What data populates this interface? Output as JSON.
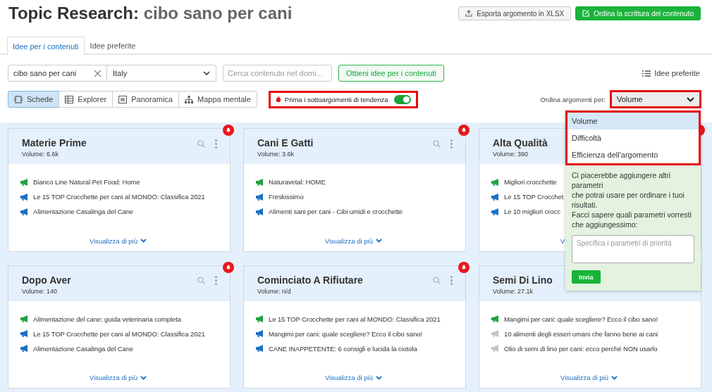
{
  "title": {
    "prefix": "Topic Research:",
    "topic": "cibo sano per cani"
  },
  "actions": [
    {
      "label": "Esporta argomento in XLSX",
      "kind": "export"
    },
    {
      "label": "Ordina la scrittura del contenuto",
      "kind": "order"
    }
  ],
  "tabs": [
    {
      "label": "Idee per i contenuti",
      "selected": true
    },
    {
      "label": "Idee preferite",
      "selected": false
    }
  ],
  "search": {
    "value": "cibo sano per cani",
    "country": "Italy",
    "domain_placeholder": "Cerca contenuto nel domi...",
    "submit": "Ottieni idee per i contenuti",
    "favorites": "Idee preferite"
  },
  "views": [
    {
      "label": "Schede",
      "selected": true,
      "kind": "cards"
    },
    {
      "label": "Explorer",
      "selected": false,
      "kind": "table"
    },
    {
      "label": "Panoramica",
      "selected": false,
      "kind": "overview"
    },
    {
      "label": "Mappa mentale",
      "selected": false,
      "kind": "map"
    }
  ],
  "trending_toggle": {
    "label": "Prima i sottoargomenti di tendenza",
    "on": true,
    "highlighted": true
  },
  "sort": {
    "label": "Ordina argomenti per:",
    "value": "Volume",
    "highlighted": true,
    "options_highlighted": true,
    "options": [
      {
        "label": "Volume",
        "selected": true
      },
      {
        "label": "Difficoltà",
        "selected": false
      },
      {
        "label": "Efficienza dell'argomento",
        "selected": false
      }
    ],
    "feedback": {
      "text": "Ci piacerebbe aggiungere altri parametri\nche potrai usare per ordinare i tuoi risultati.\nFacci sapere quali parametri vorresti che aggiungessimo:",
      "placeholder": "Specifica i parametri di priorità",
      "button": "Invia"
    }
  },
  "cards": [
    {
      "title": "Materie Prime",
      "volume_label": "Volume:",
      "volume": "6.6k",
      "trending": true,
      "tools": true,
      "link": "Visualizza di più",
      "items": [
        {
          "text": "Bianco Line Natural Pet Food: Home",
          "color": "#21a340"
        },
        {
          "text": "Le 15 TOP Crocchette per cani al MONDO: Classifica 2021",
          "color": "#1a6fc4"
        },
        {
          "text": "Alimentazione Casalinga del Cane",
          "color": "#1a6fc4"
        }
      ]
    },
    {
      "title": "Cani E Gatti",
      "volume_label": "Volume:",
      "volume": "3.6k",
      "trending": true,
      "tools": true,
      "link": "Visualizza di più",
      "items": [
        {
          "text": "Naturavetal: HOME",
          "color": "#21a340"
        },
        {
          "text": "Freskissimo",
          "color": "#1a6fc4"
        },
        {
          "text": "Alimenti sani per cani - Cibi umidi e crocchette",
          "color": "#1a6fc4"
        }
      ]
    },
    {
      "title": "Alta Qualità",
      "volume_label": "Volume:",
      "volume": "390",
      "trending": true,
      "link": "V",
      "items": [
        {
          "text": "Migliori crocchette",
          "color": "#21a340"
        },
        {
          "text": "Le 15 TOP Crocchet",
          "color": "#1a6fc4"
        },
        {
          "text": "Le 10 migliori crocc",
          "color": "#1a6fc4"
        }
      ]
    },
    {
      "title": "Dopo Aver",
      "volume_label": "Volume:",
      "volume": "140",
      "trending": true,
      "tools": true,
      "link": "Visualizza di più",
      "items": [
        {
          "text": "Alimentazione del cane: guida veterinaria completa",
          "color": "#21a340"
        },
        {
          "text": "Le 15 TOP Crocchette per cani al MONDO: Classifica 2021",
          "color": "#1a6fc4"
        },
        {
          "text": "Alimentazione Casalinga del Cane",
          "color": "#1a6fc4"
        }
      ]
    },
    {
      "title": "Cominciato A Rifiutare",
      "volume_label": "Volume:",
      "volume": "n/d",
      "trending": true,
      "tools": true,
      "link": "Visualizza di più",
      "items": [
        {
          "text": "Le 15 TOP Crocchette per cani al MONDO: Classifica 2021",
          "color": "#21a340"
        },
        {
          "text": "Mangimi per cani: quale scegliere? Ecco il cibo sano!",
          "color": "#1a6fc4"
        },
        {
          "text": "CANE INAPPETENTE: 6 consigli e lucida la ciotola",
          "color": "#1a6fc4"
        }
      ]
    },
    {
      "title": "Semi Di Lino",
      "volume_label": "Volume:",
      "volume": "27.1k",
      "link": "Visualizza di più",
      "items": [
        {
          "text": "Mangimi per cani: quale scegliere? Ecco il cibo sano!",
          "color": "#21a340"
        },
        {
          "text": "10 alimenti degli esseri umani che fanno bene ai cani",
          "color": "#c4c4c4"
        },
        {
          "text": "Olio di semi di lino per cani: ecco perché NON usarlo",
          "color": "#c4c4c4"
        }
      ]
    }
  ]
}
